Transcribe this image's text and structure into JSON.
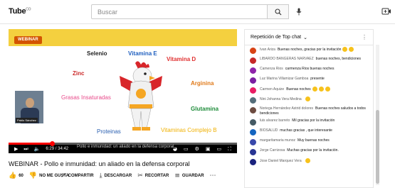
{
  "header": {
    "logo_text": "Tube",
    "logo_sup": "CO",
    "search_placeholder": "Buscar"
  },
  "slide": {
    "badge": "WEBINAR",
    "words": [
      {
        "text": "Selenio",
        "color": "#222222"
      },
      {
        "text": "Vitamina E",
        "color": "#1f5fbf"
      },
      {
        "text": "Vitamina D",
        "color": "#e03030"
      },
      {
        "text": "Zinc",
        "color": "#cc2a2a"
      },
      {
        "text": "Arginina",
        "color": "#e07a1a"
      },
      {
        "text": "Grasas Insaturadas",
        "color": "#e84a8a"
      },
      {
        "text": "Glutamina",
        "color": "#1e8c3a"
      },
      {
        "text": "Proteinas",
        "color": "#2a5fb0"
      },
      {
        "text": "Vitaminas Complejo B",
        "color": "#f0b000"
      }
    ],
    "speaker_tag": "Pablo Sánchez"
  },
  "player": {
    "time": "6:29 / 34:42",
    "subtitle": "Pollo e inmunidad: un aliado en la defensa corporal",
    "progress": 0.19
  },
  "video": {
    "title": "WEBINAR - Pollo e inmunidad: un aliado en la defensa corporal",
    "likes": "60",
    "dislike": "NO ME GUSTA",
    "share": "COMPARTIR",
    "download": "DESCARGAR",
    "clip": "RECORTAR",
    "save": "GUARDAR"
  },
  "chat": {
    "header": "Repetición de Top chat",
    "messages": [
      {
        "author": "Ivan Ariza",
        "text": "Buenas noches, gracias por la invitación",
        "color": "#d84315",
        "emoji": 2
      },
      {
        "author": "LIBARDO BANGERAS NARVAEZ",
        "text": "buenas noches, bendiciones",
        "color": "#c62828",
        "emoji": 0
      },
      {
        "author": "Camenza Rios",
        "text": "carmenza Rios buenas noches",
        "color": "#8e24aa",
        "emoji": 0
      },
      {
        "author": "Luz Marina Villamizar Gamboa",
        "text": "presente",
        "color": "#7b1fa2",
        "emoji": 0
      },
      {
        "author": "Carmen Aquize",
        "text": "Buenas noches",
        "color": "#e91e63",
        "emoji": 3
      },
      {
        "author": "Nini Johanna Vera Medina",
        "text": "",
        "color": "#546e7a",
        "emoji": 1
      },
      {
        "author": "Noriega Hernández Astrid dolores",
        "text": "Buenas noches saludos a todos bendiciones",
        "color": "#6d4c41",
        "emoji": 0
      },
      {
        "author": "luis alvarez barreto",
        "text": "Mil gracias por la invitación",
        "color": "#455a64",
        "emoji": 0
      },
      {
        "author": "BIOSALUD",
        "text": "muchas gracias , que interesante",
        "color": "#1565c0",
        "emoji": 0
      },
      {
        "author": "margaritamaria munoz",
        "text": "Muy buenas noches",
        "color": "#3949ab",
        "emoji": 0
      },
      {
        "author": "Jorge Carrizosa",
        "text": "Muchas gracias por la invitación.",
        "color": "#283593",
        "emoji": 0
      },
      {
        "author": "Jose Daniel Marquez Vera",
        "text": "",
        "color": "#1a237e",
        "emoji": 1
      }
    ]
  }
}
